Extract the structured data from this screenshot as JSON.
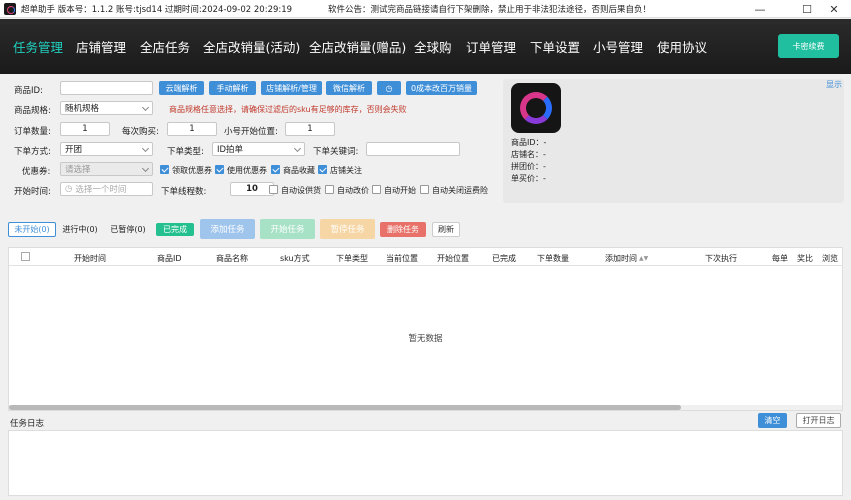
{
  "titlebar": {
    "title": "超单助手 版本号：1.1.2 账号:tjsd14 过期时间:2024-09-02 20:29:19",
    "notice": "软件公告：测试完商品链接请自行下架删除，禁止用于非法犯法途径，否则后果自负！",
    "minimize": "—",
    "maximize": "☐",
    "close": "✕"
  },
  "nav": {
    "items": [
      "任务管理",
      "店铺管理",
      "全店任务",
      "全店改销量(活动)",
      "全店改销量(赠品)",
      "全球购",
      "订单管理",
      "下单设置",
      "小号管理",
      "使用协议"
    ],
    "kami_button": "卡密续费"
  },
  "form": {
    "product_id_label": "商品ID:",
    "product_id_value": "",
    "btn_cloud": "云端解析",
    "btn_manual": "手动解析",
    "btn_store": "店铺解析/管理",
    "btn_wechat": "微信解析",
    "btn_clock": "◷",
    "btn_zero_cost": "0成本改百万销量",
    "spec_label": "商品规格:",
    "spec_value": "随机规格",
    "spec_warning": "商品规格任意选择，请确保过滤后的sku有足够的库存，否则会失败",
    "order_qty_label": "订单数量:",
    "order_qty_value": "1",
    "per_buy_label": "每次购买:",
    "per_buy_value": "1",
    "start_pos_label": "小号开始位置:",
    "start_pos_value": "1",
    "order_mode_label": "下单方式:",
    "order_mode_value": "开团",
    "order_type_label": "下单类型:",
    "order_type_value": "ID拍单",
    "keyword_label": "下单关键词:",
    "keyword_value": "",
    "coupon_label": "优惠券:",
    "coupon_placeholder": "请选择",
    "cb_get_coupon": "领取优惠券",
    "cb_use_coupon": "使用优惠券",
    "cb_fav_product": "商品收藏",
    "cb_follow_store": "店铺关注",
    "start_time_label": "开始时间:",
    "start_time_placeholder": "选择一个时间",
    "threads_label": "下单线程数:",
    "threads_value": "10",
    "cb_auto_ship": "自动设供货",
    "cb_auto_price": "自动改价",
    "cb_auto_start": "自动开始",
    "cb_auto_close_freight": "自动关闭运费险"
  },
  "product": {
    "display_link": "显示",
    "id_line": "商品ID：-",
    "store_line": "店铺名：-",
    "group_price_line": "拼团价：-",
    "single_price_line": "单买价：-"
  },
  "tabs": {
    "not_started": "未开始(0)",
    "in_progress": "进行中(0)",
    "paused": "已暂停(0)",
    "completed": "已完成"
  },
  "actions": {
    "add": "添加任务",
    "start": "开始任务",
    "pause": "暂停任务",
    "delete": "删除任务",
    "refresh": "刷新"
  },
  "table": {
    "headers": [
      "开始时间",
      "商品ID",
      "商品名称",
      "sku方式",
      "下单类型",
      "当前位置",
      "开始位置",
      "已完成",
      "下单数量",
      "添加时间",
      "下次执行",
      "每单",
      "奖比",
      "浏览"
    ],
    "empty": "暂无数据"
  },
  "log": {
    "label": "任务日志",
    "clear": "清空",
    "open": "打开日志"
  },
  "colors": {
    "nav_active": "#1fd1c0",
    "primary": "#3f8fd8",
    "completed_green": "#25c08f",
    "warning_red": "#c0392b"
  }
}
